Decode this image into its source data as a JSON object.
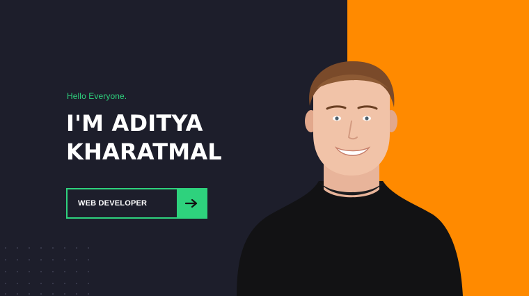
{
  "hero": {
    "greeting": "Hello Everyone.",
    "name_line1": "I'M ADITYA",
    "name_line2": "KHARATMAL",
    "role_button_label": "WEB DEVELOPER",
    "arrow_icon": "arrow-right-icon"
  },
  "colors": {
    "background_dark": "#1d1e2b",
    "accent_orange": "#ff8a00",
    "accent_green": "#2ed27d",
    "text_white": "#ffffff"
  }
}
